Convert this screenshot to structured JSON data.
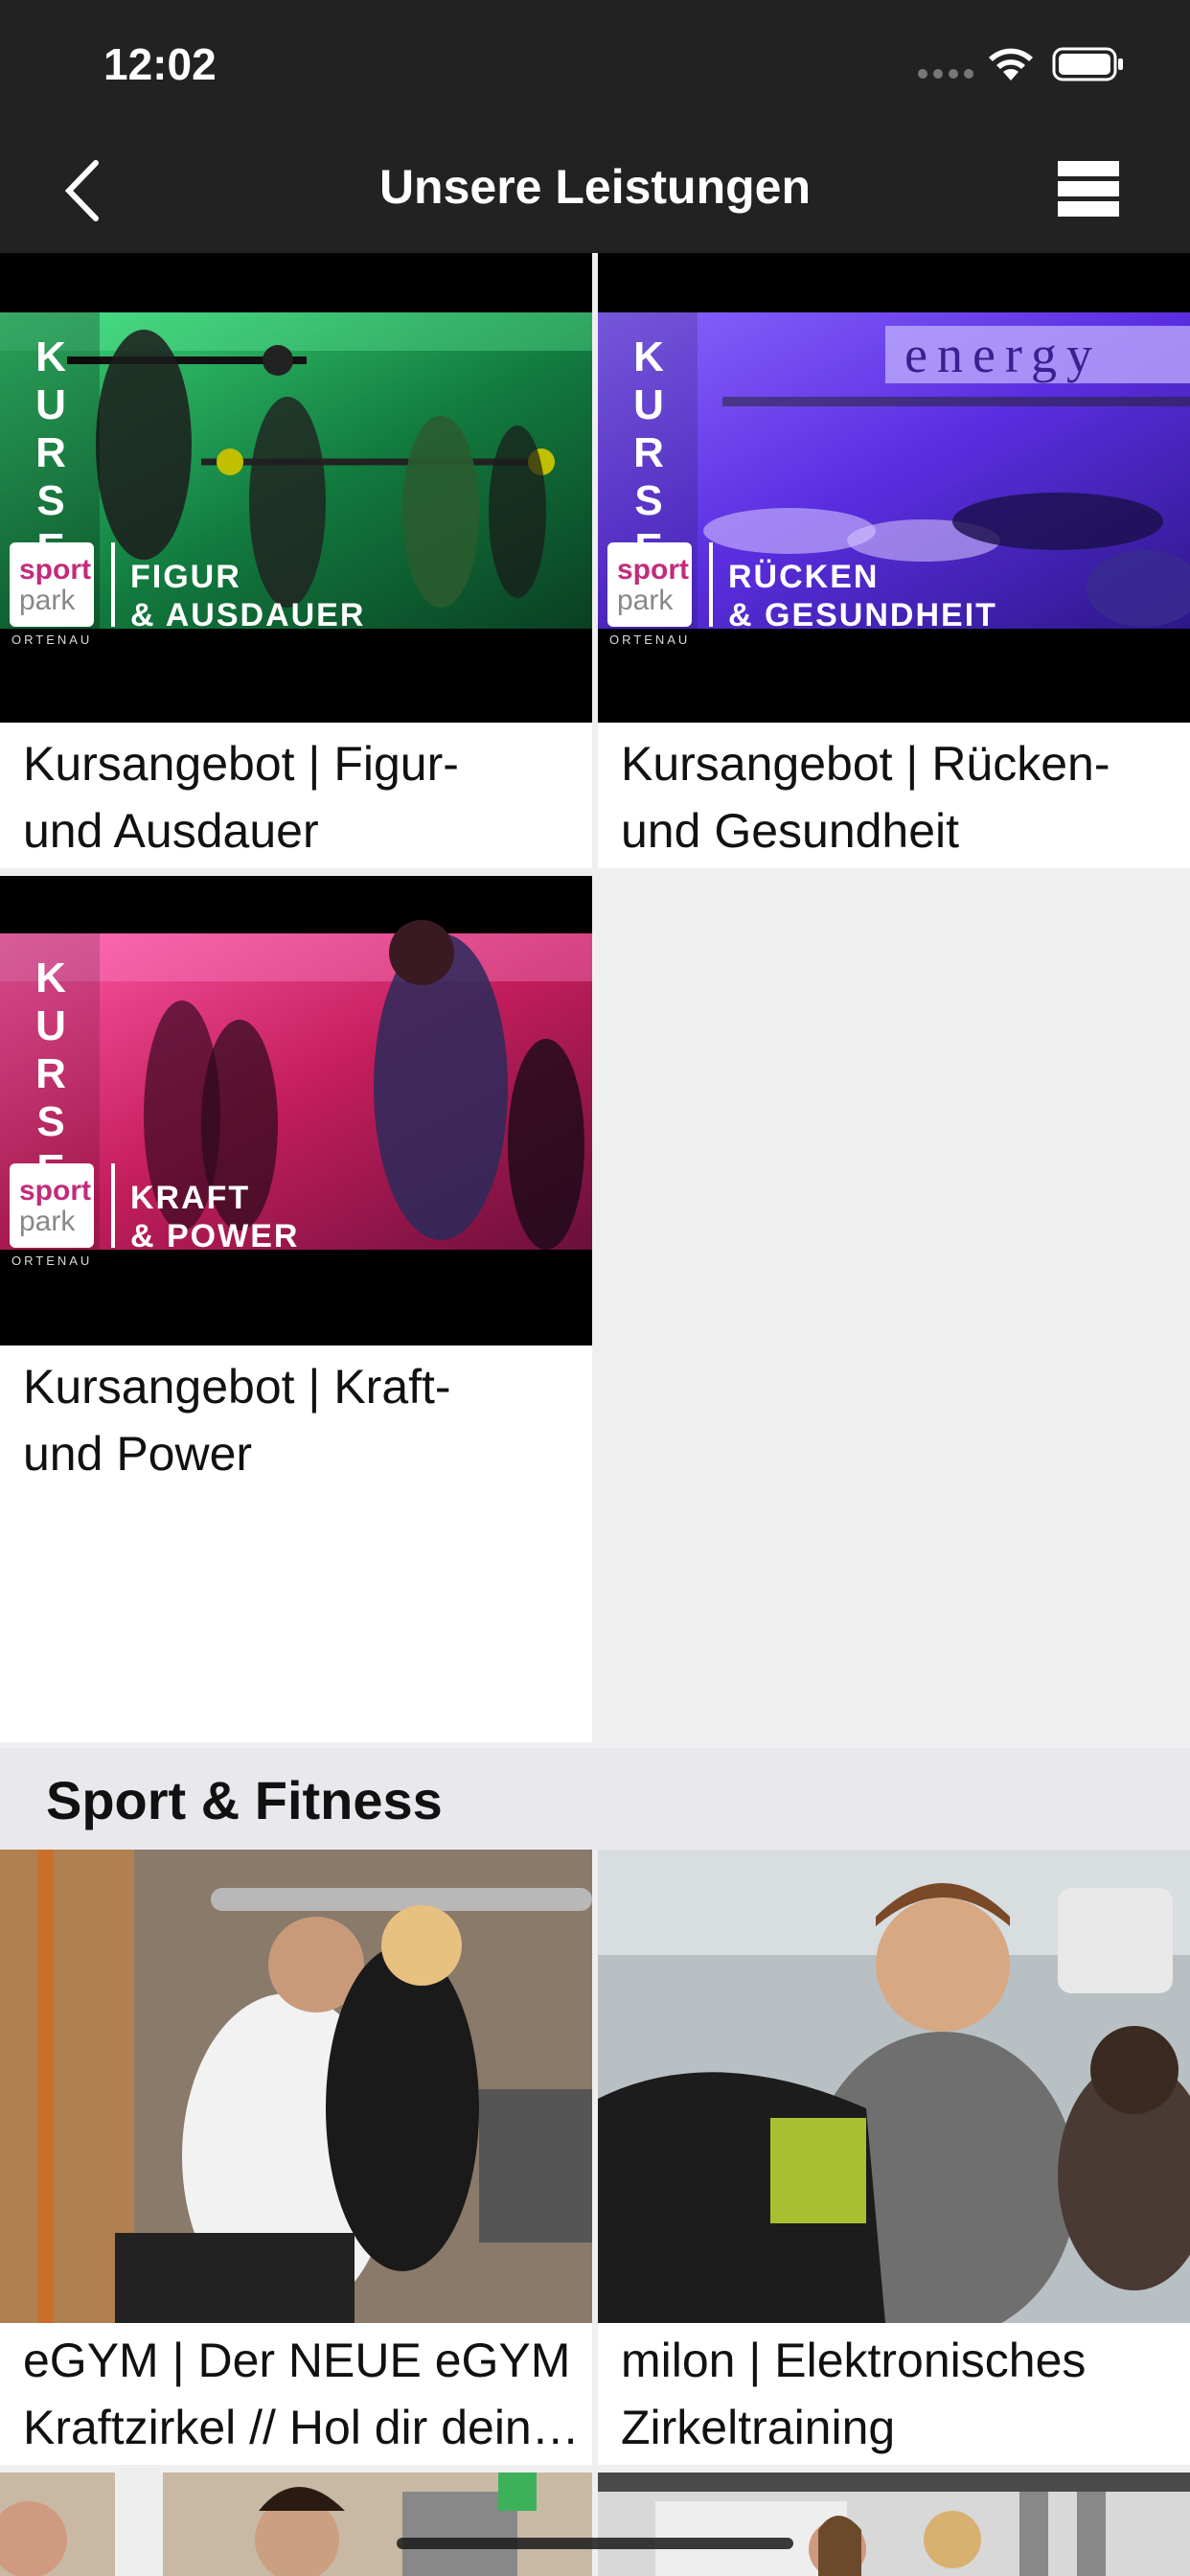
{
  "status": {
    "time": "12:02"
  },
  "nav": {
    "title": "Unsere Leistungen"
  },
  "courses": [
    {
      "caption": [
        "Kursangebot | Figur-",
        "und Ausdauer"
      ],
      "banner_kurse": [
        "K",
        "U",
        "R",
        "S",
        "E"
      ],
      "banner_logo": [
        "sport",
        "park"
      ],
      "banner_region": "ORTENAU",
      "banner_text": [
        "FIGUR",
        "& AUSDAUER"
      ],
      "color": "#2fd36a"
    },
    {
      "caption": [
        "Kursangebot | Rücken-",
        "und Gesundheit"
      ],
      "banner_kurse": [
        "K",
        "U",
        "R",
        "S",
        "E"
      ],
      "banner_logo": [
        "sport",
        "park"
      ],
      "banner_region": "ORTENAU",
      "banner_text": [
        "RÜCKEN",
        "& GESUNDHEIT"
      ],
      "color": "#6a3cf0"
    },
    {
      "caption": [
        "Kursangebot | Kraft-",
        "und Power"
      ],
      "banner_kurse": [
        "K",
        "U",
        "R",
        "S",
        "E"
      ],
      "banner_logo": [
        "sport",
        "park"
      ],
      "banner_region": "ORTENAU",
      "banner_text": [
        "KRAFT",
        "& POWER"
      ],
      "color": "#e0306f"
    }
  ],
  "section": {
    "title": "Sport & Fitness"
  },
  "fitness": [
    {
      "caption": [
        "eGYM | Der NEUE eGYM",
        "Kraftzirkel // Hol dir dein…"
      ]
    },
    {
      "caption": [
        "milon | Elektronisches",
        "Zirkeltraining"
      ]
    },
    {
      "caption": []
    },
    {
      "caption": []
    }
  ],
  "colors": {
    "bar_bg": "#222222",
    "page_bg": "#efefef",
    "section_bg": "#e9e9ed"
  }
}
